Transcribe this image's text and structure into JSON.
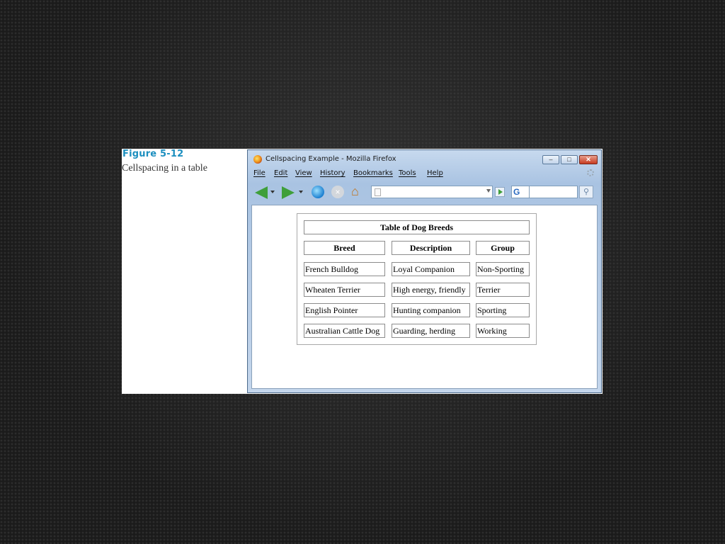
{
  "figure": {
    "number": "Figure 5-12",
    "caption": "Cellspacing in a table"
  },
  "window": {
    "title": "Cellspacing Example - Mozilla Firefox",
    "controls": {
      "minimize": "–",
      "maximize": "□",
      "close": "✕"
    }
  },
  "menu": [
    "File",
    "Edit",
    "View",
    "History",
    "Bookmarks",
    "Tools",
    "Help"
  ],
  "toolbar": {
    "url_value": "",
    "search_engine": "G",
    "search_value": "",
    "search_icon": "magnifier-icon"
  },
  "table": {
    "caption": "Table of Dog Breeds",
    "headers": [
      "Breed",
      "Description",
      "Group"
    ],
    "rows": [
      [
        "French Bulldog",
        "Loyal Companion",
        "Non-Sporting"
      ],
      [
        "Wheaten Terrier",
        "High energy, friendly",
        "Terrier"
      ],
      [
        "English Pointer",
        "Hunting companion",
        "Sporting"
      ],
      [
        "Australian Cattle Dog",
        "Guarding, herding",
        "Working"
      ]
    ]
  },
  "colors": {
    "figure_label": "#1c8fbf",
    "window_frame": "#b8cde6",
    "close_button": "#c63b20",
    "nav_arrows": "#3f9f3a"
  }
}
